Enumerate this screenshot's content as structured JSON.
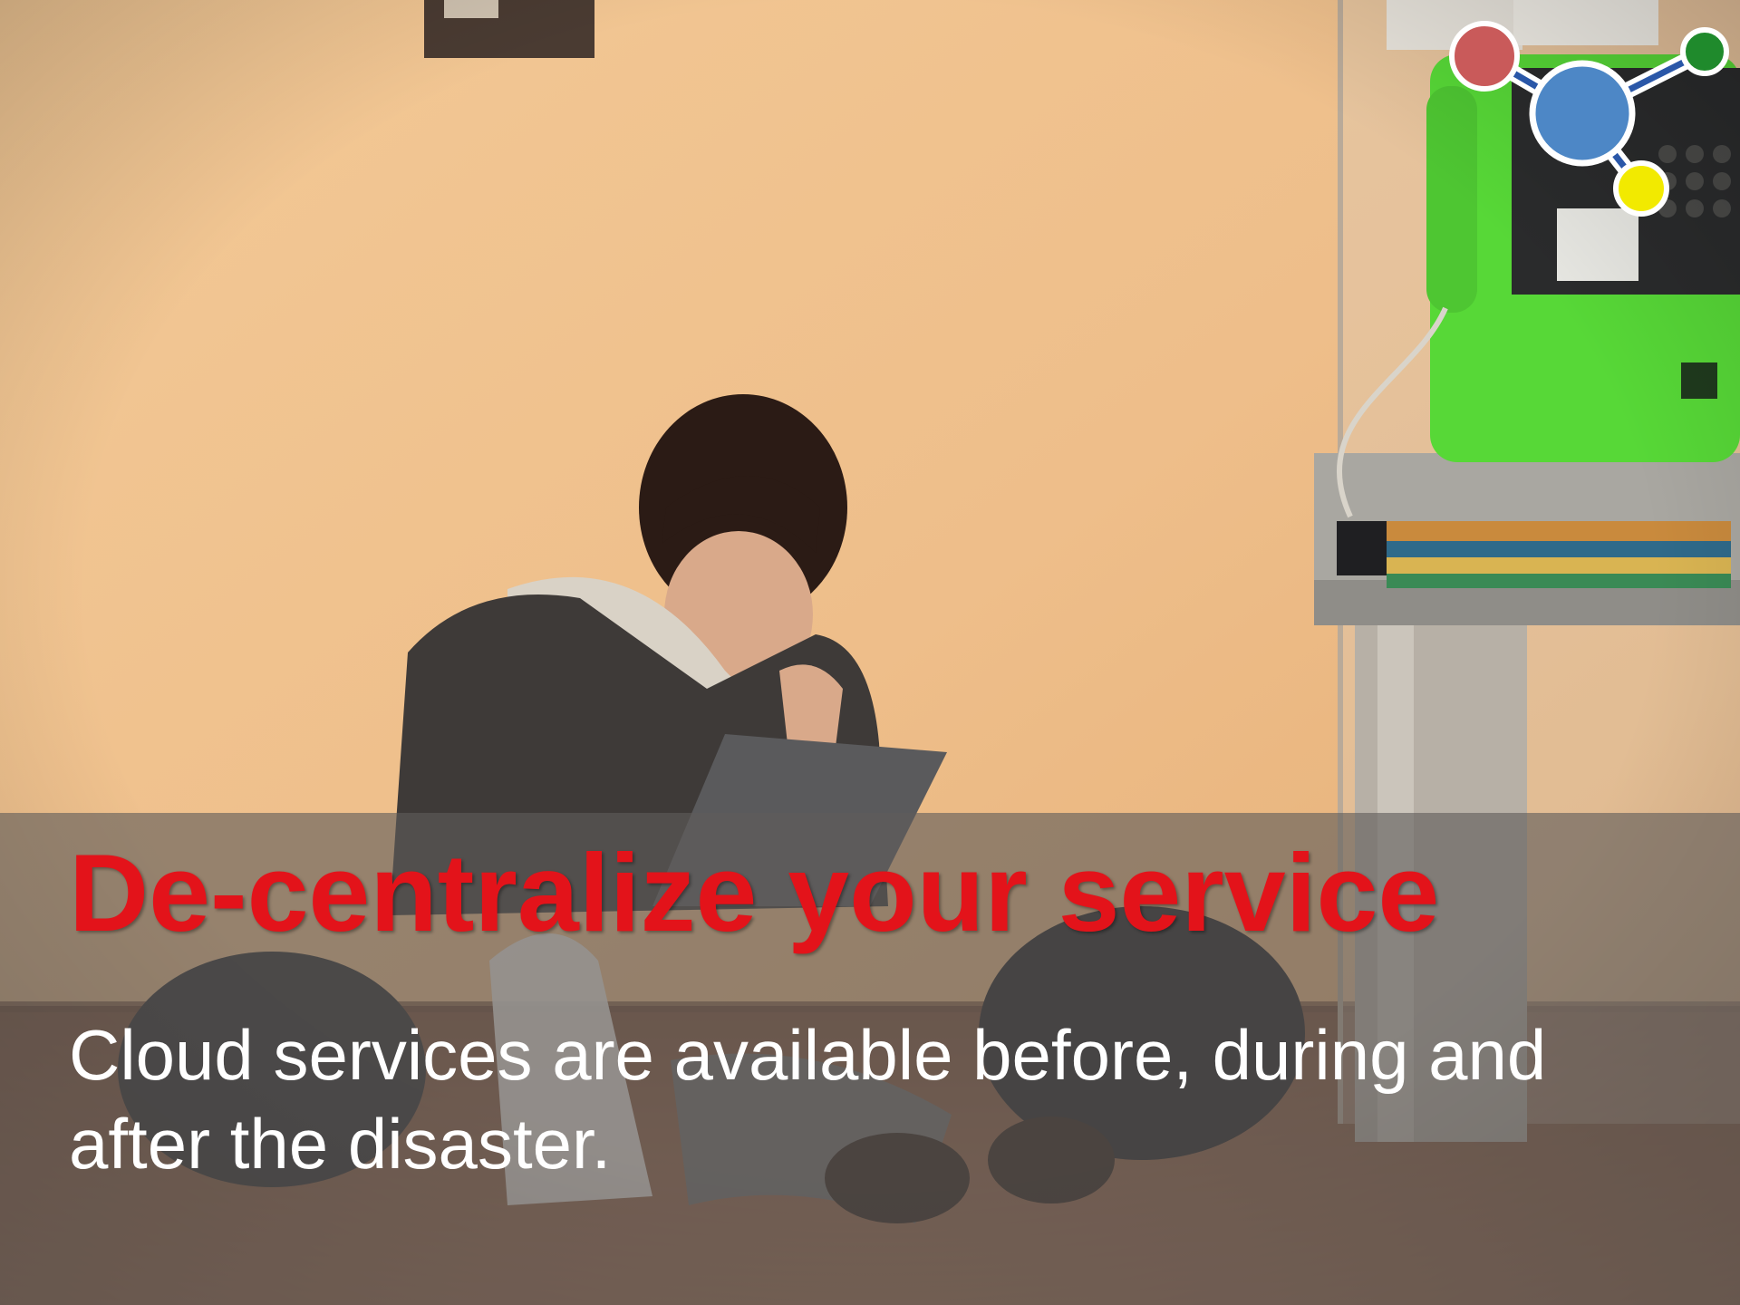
{
  "slide": {
    "headline": "De-centralize your service",
    "body": "Cloud services are available before, during and after the disaster."
  },
  "photo": {
    "subject": "person-on-phone-with-laptop",
    "background_color": "#eebe8a",
    "floor_color": "#8a5a3f",
    "payphone_color": "#57d837"
  },
  "logo": {
    "node_colors": [
      "#c95a5a",
      "#4d87c6",
      "#1f8a2c",
      "#f2ea00"
    ]
  },
  "colors": {
    "headline": "#e3131a",
    "body": "#ffffff",
    "band": "#5f5c5a"
  }
}
